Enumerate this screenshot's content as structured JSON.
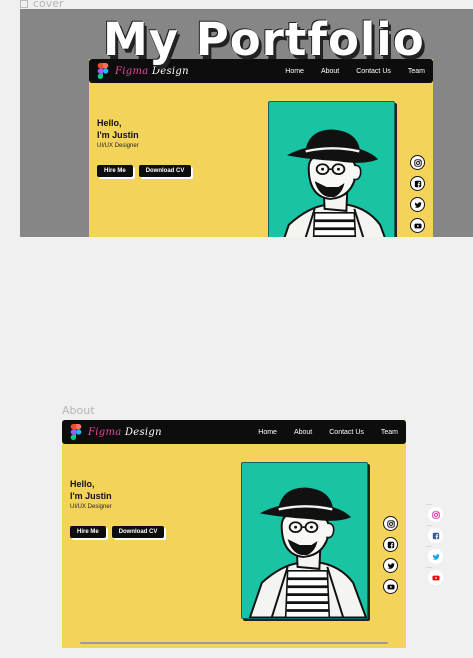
{
  "canvas": {
    "cover_label": "cover",
    "about_label": "About"
  },
  "cover": {
    "title": "My Portfolio"
  },
  "site": {
    "brand_part1": "Figma",
    "brand_part2": "Design",
    "nav": [
      "Home",
      "About",
      "Contact Us",
      "Team"
    ],
    "greeting": "Hello,",
    "name": "I'm Justin",
    "role": "UI/UX Designer",
    "hire_label": "Hire Me",
    "cv_label": "Download CV"
  },
  "social": [
    "instagram-icon",
    "facebook-icon",
    "twitter-icon",
    "youtube-icon"
  ],
  "colors": {
    "site_bg": "#f4d35b",
    "card": "#18c4a4",
    "nav": "#0d0d0d",
    "brand_accent": "#e34a9a"
  }
}
